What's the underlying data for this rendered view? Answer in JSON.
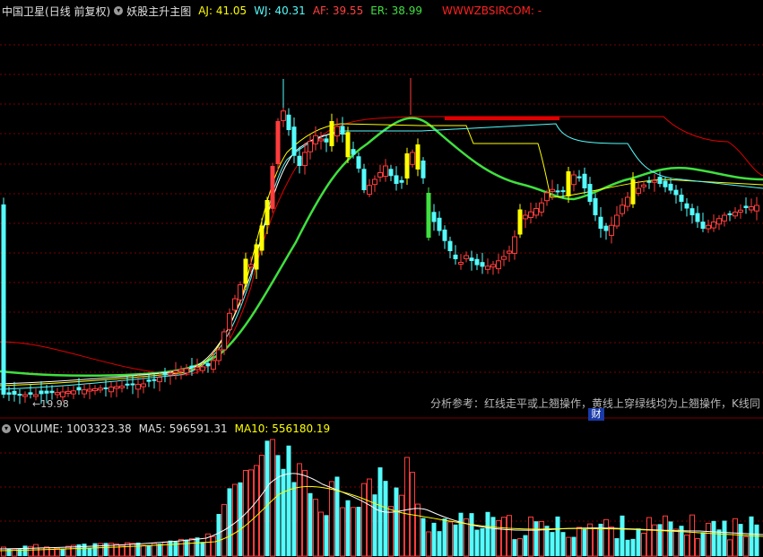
{
  "header": {
    "stock": "中国卫星",
    "period": "(日线 前复权)",
    "indicator": "妖股主升主图",
    "aj": "AJ: 41.05",
    "wj": "WJ: 40.31",
    "af": "AF: 39.55",
    "er": "ER: 38.99",
    "site": "WWWZBSIRCOM: -",
    "menu_icon": "chevron-down-icon"
  },
  "volume_header": {
    "volume": "VOLUME: 1003323.38",
    "ma5": "MA5: 596591.31",
    "ma10": "MA10: 556180.19",
    "menu_icon": "chevron-down-icon"
  },
  "annotations": {
    "low_label": "19.98",
    "analysis_note": "分析参考：红线走平或上翘操作，黄线上穿绿线均为上翘操作，K线同",
    "badge": "财"
  },
  "colors": {
    "background": "#000000",
    "up": "#ff3c3c",
    "down": "#54fcfc",
    "yellow": "#ffff00",
    "green": "#3fe03f",
    "red_line": "#e00000",
    "grid": "#7a0000",
    "label_aj": "#ffff00",
    "label_wj": "#54fcfc",
    "label_af": "#ff4040",
    "label_er": "#3fe03f",
    "label_site": "#ff2020",
    "label_ma10": "#ffff00"
  }
}
